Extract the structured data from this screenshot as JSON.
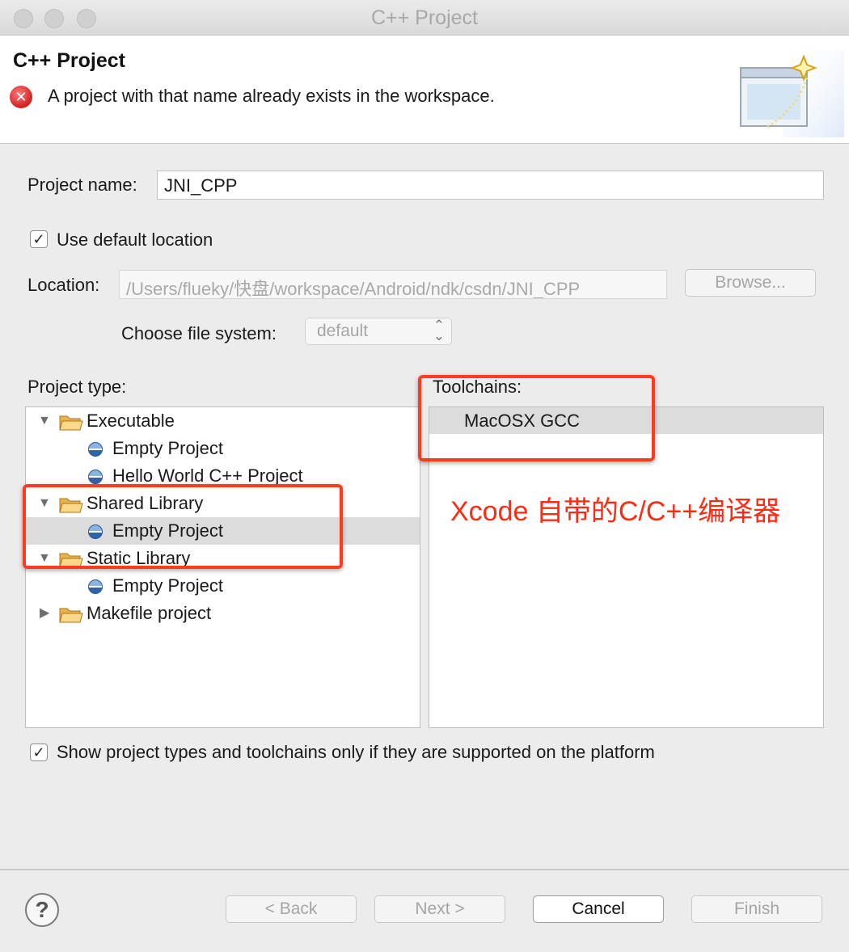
{
  "window": {
    "title": "C++ Project"
  },
  "banner": {
    "title": "C++ Project",
    "error_message": "A project with that name already exists in the workspace.",
    "error_icon": "error-x-icon"
  },
  "project_name": {
    "label": "Project name:",
    "value": "JNI_CPP"
  },
  "use_default_location": {
    "label": "Use default location",
    "checked": true
  },
  "location": {
    "label": "Location:",
    "value": "/Users/flueky/快盘/workspace/Android/ndk/csdn/JNI_CPP",
    "browse_label": "Browse..."
  },
  "file_system": {
    "label": "Choose file system:",
    "value": "default"
  },
  "project_type": {
    "label": "Project type:",
    "items": [
      {
        "label": "Executable",
        "kind": "folder",
        "expanded": true
      },
      {
        "label": "Empty Project",
        "kind": "project"
      },
      {
        "label": "Hello World C++ Project",
        "kind": "project"
      },
      {
        "label": "Shared Library",
        "kind": "folder",
        "expanded": true
      },
      {
        "label": "Empty Project",
        "kind": "project",
        "selected": true
      },
      {
        "label": "Static Library",
        "kind": "folder",
        "expanded": true
      },
      {
        "label": "Empty Project",
        "kind": "project"
      },
      {
        "label": "Makefile project",
        "kind": "folder",
        "expanded": false
      }
    ]
  },
  "toolchains": {
    "label": "Toolchains:",
    "items": [
      {
        "label": "MacOSX GCC",
        "selected": true
      }
    ]
  },
  "annotation_text": "Xcode 自带的C/C++编译器",
  "show_supported": {
    "label": "Show project types and toolchains only if they are supported on the platform",
    "checked": true
  },
  "footer": {
    "back_label": "< Back",
    "next_label": "Next >",
    "cancel_label": "Cancel",
    "finish_label": "Finish"
  },
  "colors": {
    "annotation_red": "#ff2a12",
    "selection_gray": "#dcdcdc"
  }
}
